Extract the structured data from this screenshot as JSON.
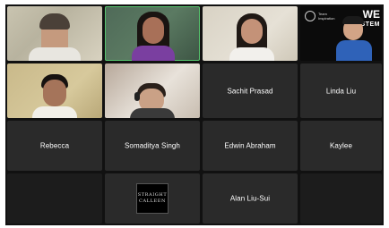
{
  "participants": [
    {
      "name": "",
      "has_video": true
    },
    {
      "name": "",
      "has_video": true,
      "active": true
    },
    {
      "name": "",
      "has_video": true
    },
    {
      "name": "",
      "has_video": true,
      "overlay": {
        "badge_line1": "Team",
        "badge_line2": "Inspiration",
        "brand_big": "WE",
        "brand_small": "STEM"
      }
    },
    {
      "name": "",
      "has_video": true
    },
    {
      "name": "",
      "has_video": true
    },
    {
      "name": "Sachit Prasad",
      "has_video": false
    },
    {
      "name": "Linda Liu",
      "has_video": false
    },
    {
      "name": "Rebecca",
      "has_video": false
    },
    {
      "name": "Somaditya Singh",
      "has_video": false
    },
    {
      "name": "Edwin Abraham",
      "has_video": false
    },
    {
      "name": "Kaylee",
      "has_video": false
    },
    {
      "name": "",
      "has_video": false,
      "empty": true
    },
    {
      "name": "",
      "has_video": false,
      "logo": {
        "line1": "STRAIGHT",
        "line2": "CALLEEN"
      }
    },
    {
      "name": "Alan Liu-Sui",
      "has_video": false
    },
    {
      "name": "",
      "has_video": false,
      "empty": true
    }
  ],
  "colors": {
    "tile_bg": "#2a2a2a",
    "stage_bg": "#111111",
    "active_border": "#57c46e"
  }
}
